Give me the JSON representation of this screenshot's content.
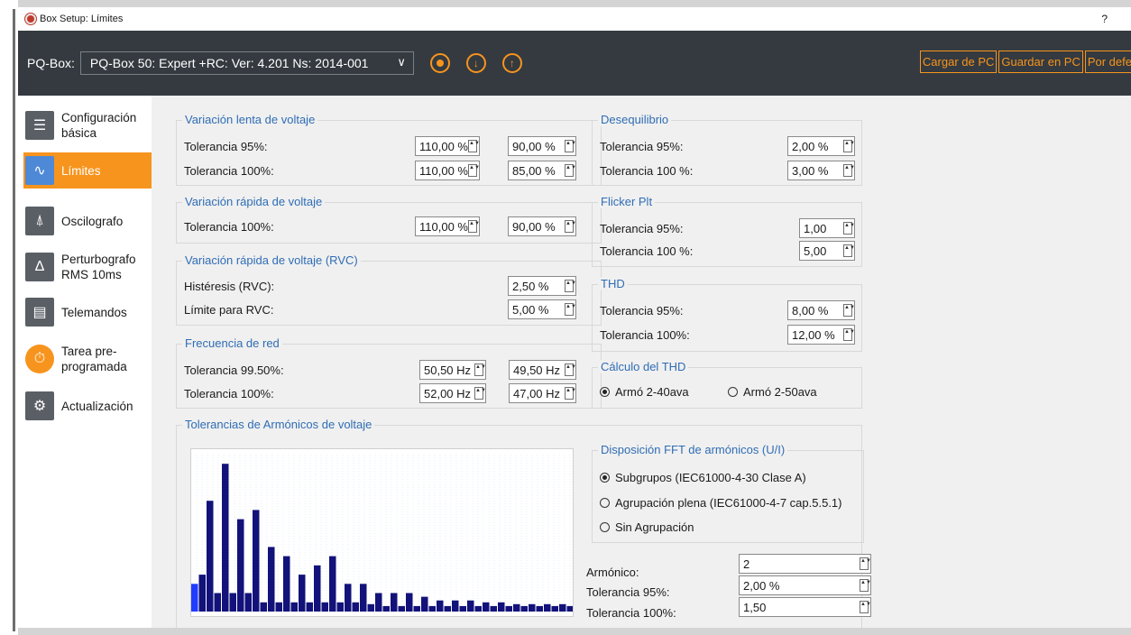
{
  "window": {
    "title": "Box Setup: Límites",
    "help": "?"
  },
  "toolbar": {
    "device_label": "PQ-Box:",
    "device_value": "PQ-Box 50: Expert +RC: Ver: 4.201 Ns: 2014-001",
    "buttons": [
      "Cargar de PC",
      "Guardar en PC",
      "Por defe"
    ]
  },
  "sidebar": {
    "items": [
      {
        "label": "Configuración básica",
        "icon": "settings-icon"
      },
      {
        "label": "Límites",
        "icon": "wave-icon",
        "active": true
      },
      {
        "label": "Oscilografo",
        "icon": "oscillograph-icon"
      },
      {
        "label": "Perturbografo RMS 10ms",
        "icon": "rms-icon"
      },
      {
        "label": "Telemandos",
        "icon": "telecontrol-icon"
      },
      {
        "label": "Tarea pre-programada",
        "icon": "timer-icon"
      },
      {
        "label": "Actualización",
        "icon": "update-icon"
      }
    ]
  },
  "groups": {
    "slow": {
      "title": "Variación lenta de voltaje",
      "r1": "Tolerancia 95%:",
      "r1a": "110,00 %",
      "r1b": "90,00 %",
      "r2": "Tolerancia 100%:",
      "r2a": "110,00 %",
      "r2b": "85,00 %"
    },
    "fast": {
      "title": "Variación rápida de voltaje",
      "r1": "Tolerancia 100%:",
      "r1a": "110,00 %",
      "r1b": "90,00 %"
    },
    "rvc": {
      "title": "Variación rápida de voltaje (RVC)",
      "r1": "Histéresis (RVC):",
      "r1a": "2,50 %",
      "r2": "Límite para RVC:",
      "r2a": "5,00 %"
    },
    "freq": {
      "title": "Frecuencia de red",
      "r1": "Tolerancia 99.50%:",
      "r1a": "50,50 Hz",
      "r1b": "49,50 Hz",
      "r2": "Tolerancia 100%:",
      "r2a": "52,00 Hz",
      "r2b": "47,00 Hz"
    },
    "unbal": {
      "title": "Desequilibrio",
      "r1": "Tolerancia 95%:",
      "r1a": "2,00 %",
      "r2": "Tolerancia 100 %:",
      "r2a": "3,00 %"
    },
    "flicker": {
      "title": "Flicker Plt",
      "r1": "Tolerancia 95%:",
      "r1a": "1,00",
      "r2": "Tolerancia 100 %:",
      "r2a": "5,00"
    },
    "thd": {
      "title": "THD",
      "r1": "Tolerancia 95%:",
      "r1a": "8,00 %",
      "r2": "Tolerancia 100%:",
      "r2a": "12,00 %"
    },
    "thdcalc": {
      "title": "Cálculo del THD",
      "opt1": "Armó 2-40ava",
      "opt2": "Armó 2-50ava",
      "selected": 1
    },
    "harm": {
      "title": "Tolerancias de Armónicos de voltaje",
      "fft_title": "Disposición FFT de armónicos (U/I)",
      "fft_opt1": "Subgrupos (IEC61000-4-30 Clase A)",
      "fft_opt2": "Agrupación plena (IEC61000-4-7 cap.5.5.1)",
      "fft_opt3": "Sin Agrupación",
      "fft_selected": 1,
      "l1": "Armónico:",
      "v1": "2",
      "l2": "Tolerancia 95%:",
      "v2": "2,00 %",
      "l3": "Tolerancia 100%:",
      "v3": "1,50"
    }
  },
  "chart_data": {
    "type": "bar",
    "series": [
      {
        "color": "#1f3cff",
        "values": [
          1.5
        ]
      },
      {
        "color": "#12127a",
        "values": [
          2.0,
          6.0,
          1.0,
          8.0,
          1.0,
          5.0,
          1.0,
          5.5,
          0.5,
          3.5,
          0.5,
          3.0,
          0.5,
          2.0,
          0.5,
          2.5,
          0.5,
          3.0,
          0.5,
          1.5,
          0.5,
          1.5,
          0.4,
          1.0,
          0.3,
          1.0,
          0.3,
          1.0,
          0.3,
          0.8,
          0.3,
          0.6,
          0.3,
          0.6,
          0.3,
          0.6,
          0.3,
          0.5,
          0.3,
          0.5,
          0.3,
          0.4,
          0.3,
          0.4,
          0.3,
          0.4,
          0.3,
          0.4,
          0.3
        ]
      }
    ],
    "ylim": [
      0,
      8.5
    ]
  }
}
